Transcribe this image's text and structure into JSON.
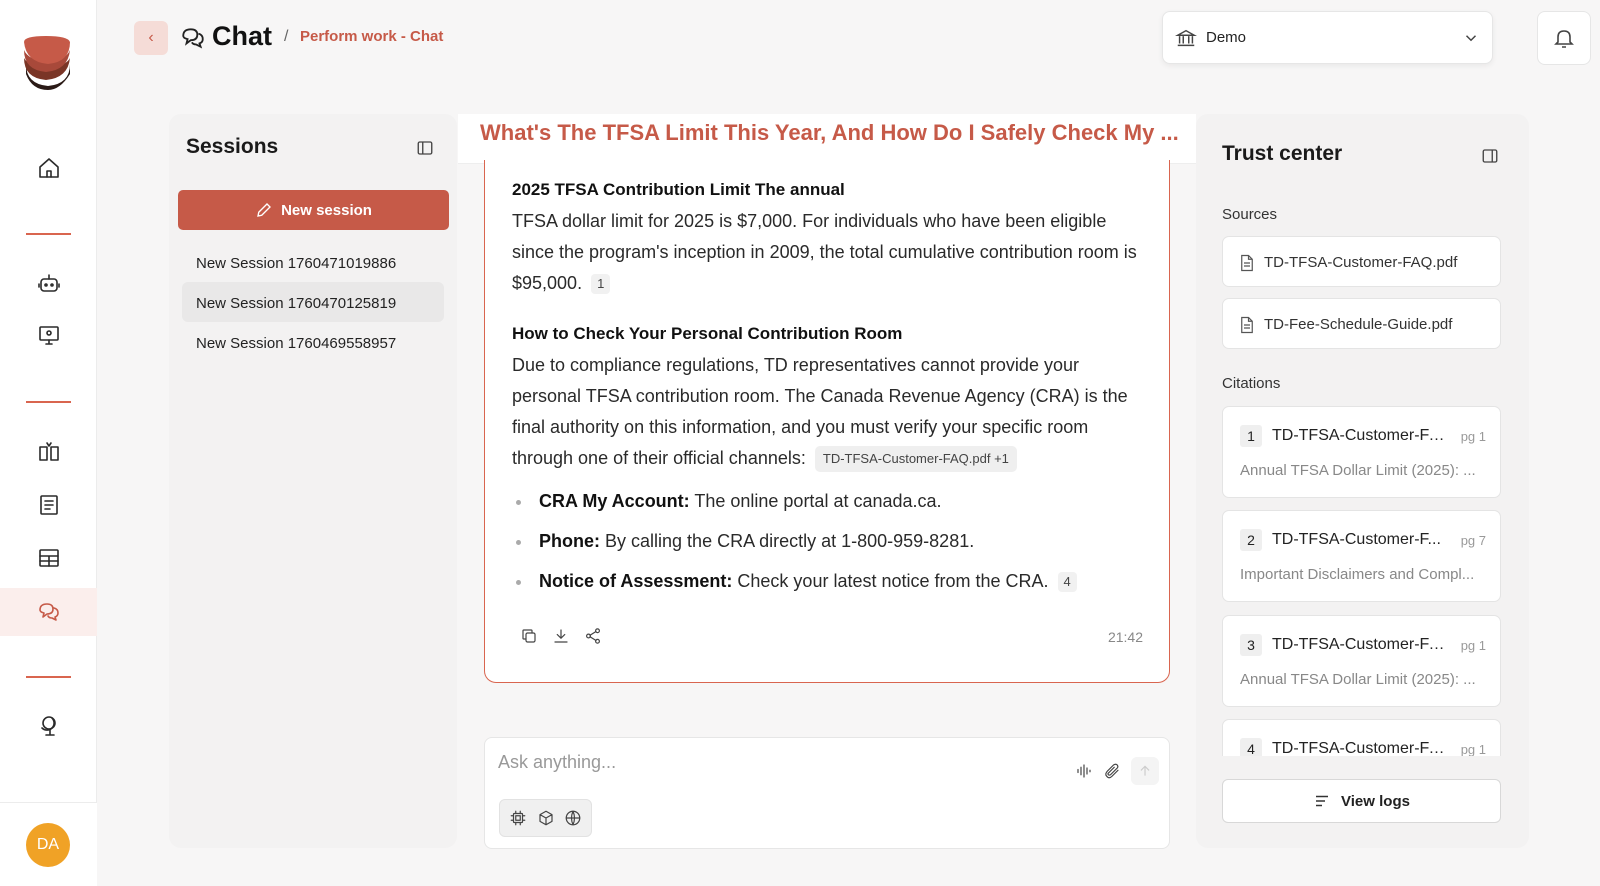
{
  "app": {
    "brand_color": "#c65a48",
    "avatar_initials": "DA",
    "avatar_color": "#f0a226"
  },
  "rail": {
    "items": [
      {
        "icon": "home-icon"
      },
      {
        "icon": "bot-icon"
      },
      {
        "icon": "monitor-settings-icon"
      },
      {
        "icon": "compare-columns-icon"
      },
      {
        "icon": "document-list-icon"
      },
      {
        "icon": "table-icon"
      },
      {
        "icon": "chat-bubbles-icon",
        "active": true
      },
      {
        "icon": "satellite-icon"
      }
    ]
  },
  "header": {
    "title": "Chat",
    "breadcrumb_sep": "/",
    "breadcrumb": "Perform work - Chat",
    "org_select": {
      "value": "Demo"
    }
  },
  "sessions": {
    "title": "Sessions",
    "new_session_label": "New session",
    "items": [
      {
        "label": "New Session 1760471019886"
      },
      {
        "label": "New Session 1760470125819",
        "active": true
      },
      {
        "label": "New Session 1760469558957"
      }
    ]
  },
  "chat": {
    "title": "What's The TFSA Limit This Year, And How Do I Safely Check My ...",
    "answer": {
      "heading1": "2025 TFSA Contribution Limit The annual",
      "para1": "TFSA dollar limit for 2025 is $7,000. For individuals who have been eligible since the program's inception in 2009, the total cumulative contribution room is $95,000.",
      "cite1": "1",
      "heading2": "How to Check Your Personal Contribution Room",
      "para2": "Due to compliance regulations, TD representatives cannot provide your personal TFSA contribution room. The Canada Revenue Agency (CRA) is the final authority on this information, and you must verify your specific room through one of their official channels:",
      "source_chip": "TD-TFSA-Customer-FAQ.pdf +1",
      "bullets": [
        {
          "term": "CRA My Account:",
          "text": "The online portal at canada.ca."
        },
        {
          "term": "Phone:",
          "text": "By calling the CRA directly at 1-800-959-8281."
        },
        {
          "term": "Notice of Assessment:",
          "text": "Check your latest notice from the CRA.",
          "cite": "4"
        }
      ],
      "time": "21:42"
    },
    "composer": {
      "placeholder": "Ask anything..."
    }
  },
  "trust": {
    "title": "Trust center",
    "sources_label": "Sources",
    "sources": [
      {
        "name": "TD-TFSA-Customer-FAQ.pdf"
      },
      {
        "name": "TD-Fee-Schedule-Guide.pdf"
      }
    ],
    "citations_label": "Citations",
    "citations": [
      {
        "num": "1",
        "name": "TD-TFSA-Customer-FA...",
        "page": "pg 1",
        "snippet": "Annual TFSA Dollar Limit (2025): ..."
      },
      {
        "num": "2",
        "name": "TD-TFSA-Customer-F...",
        "page": "pg 7",
        "snippet": "Important Disclaimers and Compl..."
      },
      {
        "num": "3",
        "name": "TD-TFSA-Customer-FA...",
        "page": "pg 1",
        "snippet": "Annual TFSA Dollar Limit (2025): ..."
      },
      {
        "num": "4",
        "name": "TD-TFSA-Customer-FA...",
        "page": "pg 1",
        "snippet": ""
      }
    ],
    "view_logs_label": "View logs"
  }
}
